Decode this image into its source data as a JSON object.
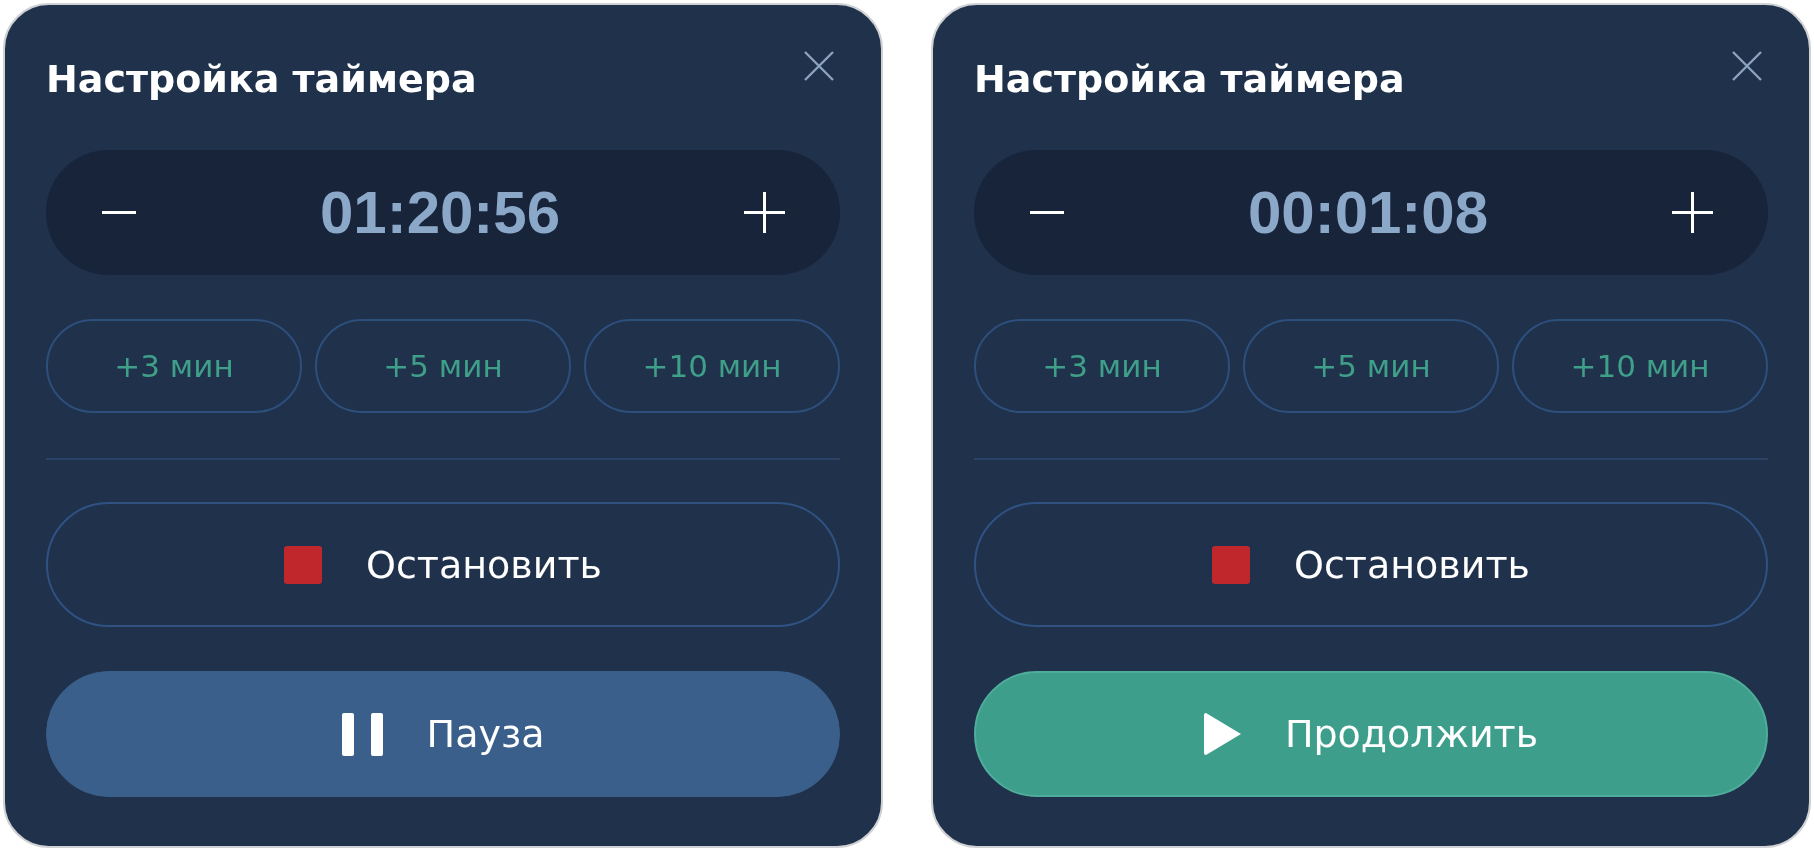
{
  "panels": [
    {
      "title": "Настройка таймера",
      "time": "01:20:56",
      "quick_add": [
        "+3 мин",
        "+5 мин",
        "+10 мин"
      ],
      "stop": {
        "label": "Остановить"
      },
      "primary": {
        "kind": "pause",
        "label": "Пауза"
      }
    },
    {
      "title": "Настройка таймера",
      "time": "00:01:08",
      "quick_add": [
        "+3 мин",
        "+5 мин",
        "+10 мин"
      ],
      "stop": {
        "label": "Остановить"
      },
      "primary": {
        "kind": "resume",
        "label": "Продолжить"
      }
    }
  ]
}
